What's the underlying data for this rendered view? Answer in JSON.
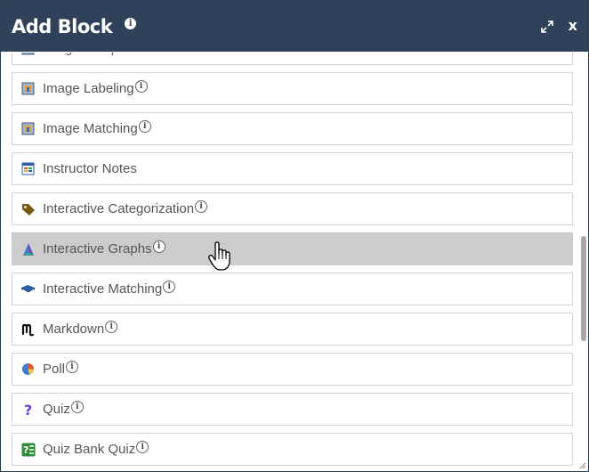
{
  "dialog": {
    "title": "Add Block",
    "info_glyph": "i",
    "close_label": "x"
  },
  "items": [
    {
      "label": "Image Hotspots",
      "icon": "image-hotspots-icon",
      "info": true
    },
    {
      "label": "Image Labeling",
      "icon": "image-labeling-icon",
      "info": true
    },
    {
      "label": "Image Matching",
      "icon": "image-matching-icon",
      "info": true
    },
    {
      "label": "Instructor Notes",
      "icon": "instructor-notes-icon",
      "info": false
    },
    {
      "label": "Interactive Categorization",
      "icon": "tag-icon",
      "info": true
    },
    {
      "label": "Interactive Graphs",
      "icon": "graph-icon",
      "info": true,
      "hovered": true
    },
    {
      "label": "Interactive Matching",
      "icon": "book-icon",
      "info": true
    },
    {
      "label": "Markdown",
      "icon": "markdown-icon",
      "info": true
    },
    {
      "label": "Poll",
      "icon": "pie-chart-icon",
      "info": true
    },
    {
      "label": "Quiz",
      "icon": "question-icon",
      "info": true
    },
    {
      "label": "Quiz Bank Quiz",
      "icon": "quiz-bank-icon",
      "info": true
    }
  ],
  "colors": {
    "titlebar": "#2f4259",
    "hover_row": "#cccccc",
    "label_text": "#555555"
  }
}
